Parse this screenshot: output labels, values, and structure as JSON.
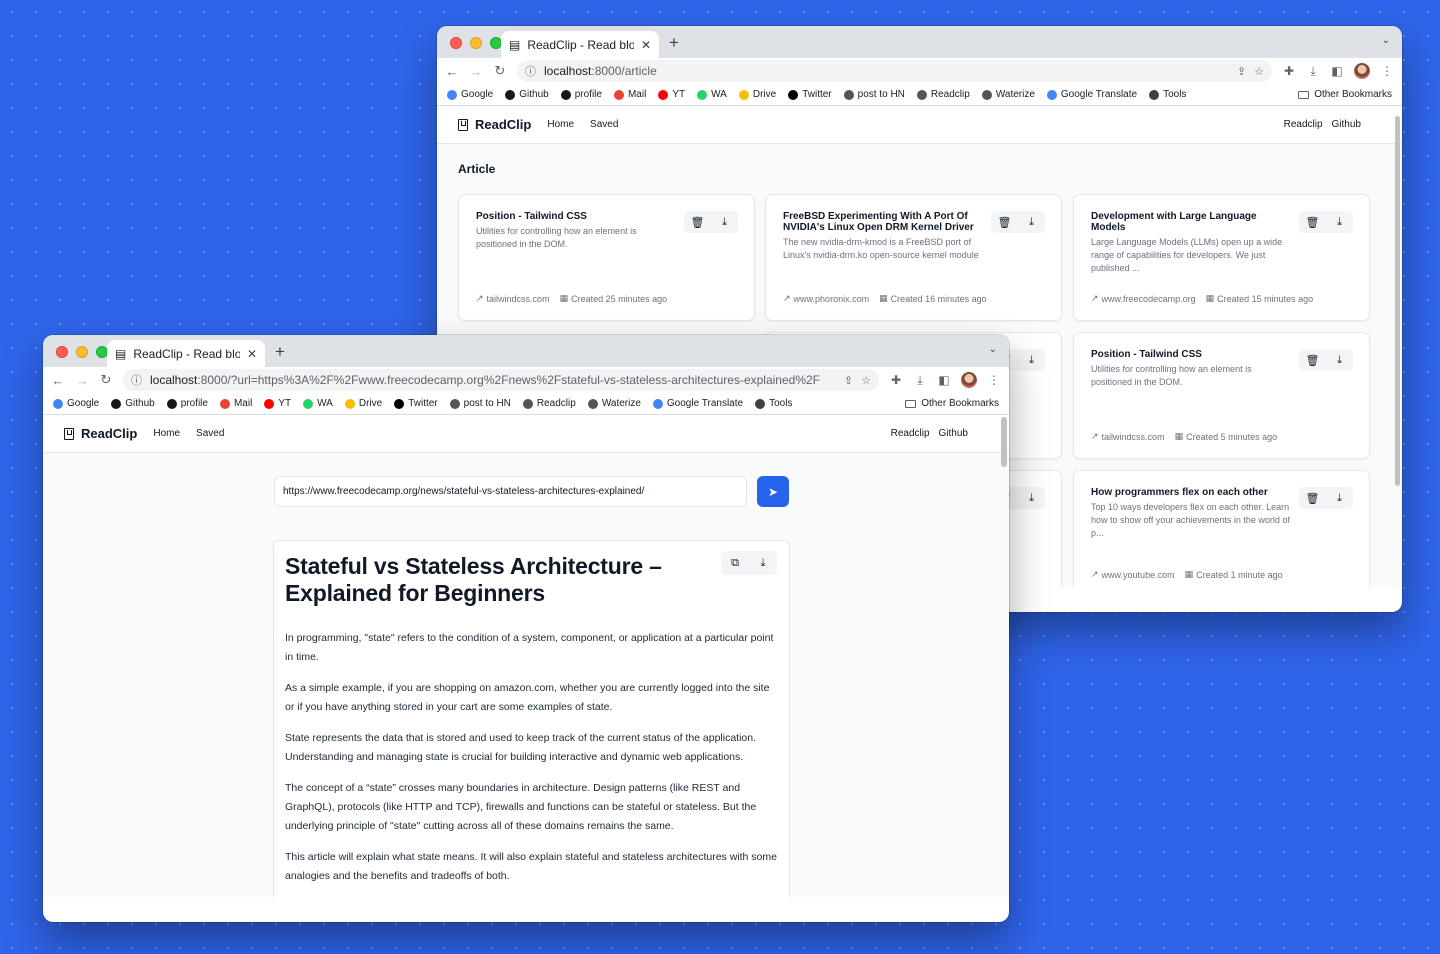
{
  "browser": {
    "bookmarks": [
      {
        "label": "Google",
        "icon": "google-icon",
        "color": "#4285f4"
      },
      {
        "label": "Github",
        "icon": "github-icon",
        "color": "#181717"
      },
      {
        "label": "profile",
        "icon": "github-icon",
        "color": "#181717"
      },
      {
        "label": "Mail",
        "icon": "gmail-icon",
        "color": "#ea4335"
      },
      {
        "label": "YT",
        "icon": "youtube-icon",
        "color": "#ff0000"
      },
      {
        "label": "WA",
        "icon": "whatsapp-icon",
        "color": "#25d366"
      },
      {
        "label": "Drive",
        "icon": "drive-icon",
        "color": "#fbbc04"
      },
      {
        "label": "Twitter",
        "icon": "x-icon",
        "color": "#000000"
      },
      {
        "label": "post to HN",
        "icon": "globe-icon",
        "color": "#555555"
      },
      {
        "label": "Readclip",
        "icon": "globe-icon",
        "color": "#555555"
      },
      {
        "label": "Waterize",
        "icon": "globe-icon",
        "color": "#555555"
      },
      {
        "label": "Google Translate",
        "icon": "translate-icon",
        "color": "#4285f4"
      },
      {
        "label": "Tools",
        "icon": "tools-icon",
        "color": "#3c4043"
      }
    ],
    "other_bookmarks": "Other Bookmarks"
  },
  "back_window": {
    "tab_title": "ReadClip - Read blog or news",
    "url_host": "localhost",
    "url_rest": ":8000/article",
    "nav": {
      "brand": "ReadClip",
      "home": "Home",
      "saved": "Saved",
      "readclip": "Readclip",
      "github": "Github"
    },
    "section_title": "Article",
    "cards": [
      {
        "title": "Position - Tailwind CSS",
        "desc": "Utilities for controlling how an element is positioned in the DOM.",
        "site": "tailwindcss.com",
        "created": "Created 25 minutes ago"
      },
      {
        "title": "FreeBSD Experimenting With A Port Of NVIDIA's Linux Open DRM Kernel Driver",
        "desc": "The new nvidia-drm-kmod is a FreeBSD port of Linux's nvidia-drm.ko open-source kernel module",
        "site": "www.phoronix.com",
        "created": "Created 16 minutes ago"
      },
      {
        "title": "Development with Large Language Models",
        "desc": "Large Language Models (LLMs) open up a wide range of capabilities for developers. We just published ...",
        "site": "www.freecodecamp.org",
        "created": "Created 15 minutes ago"
      },
      {
        "title": "Position - Tailwind CSS",
        "desc": "Utilities for controlling how an element is positioned in the DOM.",
        "site": "tailwindcss.com",
        "created": "Created 5 minutes ago"
      },
      {
        "title": "How programmers flex on each other",
        "desc": "Top 10 ways developers flex on each other. Learn how to show off your achievements in the world of p...",
        "site": "www.youtube.com",
        "created": "Created 1 minute ago"
      }
    ]
  },
  "front_window": {
    "tab_title": "ReadClip - Read blog or news",
    "url_host": "localhost",
    "url_rest": ":8000/?url=https%3A%2F%2Fwww.freecodecamp.org%2Fnews%2Fstateful-vs-stateless-architectures-explained%2F",
    "nav": {
      "brand": "ReadClip",
      "home": "Home",
      "saved": "Saved",
      "readclip": "Readclip",
      "github": "Github"
    },
    "url_input_value": "https://www.freecodecamp.org/news/stateful-vs-stateless-architectures-explained/",
    "article": {
      "title": "Stateful vs Stateless Architecture – Explained for Beginners",
      "paragraphs": [
        "In programming, \"state\" refers to the condition of a system, component, or application at a particular point in time.",
        "As a simple example, if you are shopping on amazon.com, whether you are currently logged into the site or if you have anything stored in your cart are some examples of state.",
        "State represents the data that is stored and used to keep track of the current status of the application. Understanding and managing state is crucial for building interactive and dynamic web applications.",
        "The concept of a “state” crosses many boundaries in architecture. Design patterns (like REST and GraphQL), protocols (like HTTP and TCP), firewalls and functions can be stateful or stateless. But the underlying principle of \"state\" cutting across all of these domains remains the same.",
        "This article will explain what state means. It will also explain stateful and stateless architectures with some analogies and the benefits and tradeoffs of both."
      ]
    }
  },
  "colors": {
    "background": "#2f64ea",
    "accent": "#2563eb"
  }
}
